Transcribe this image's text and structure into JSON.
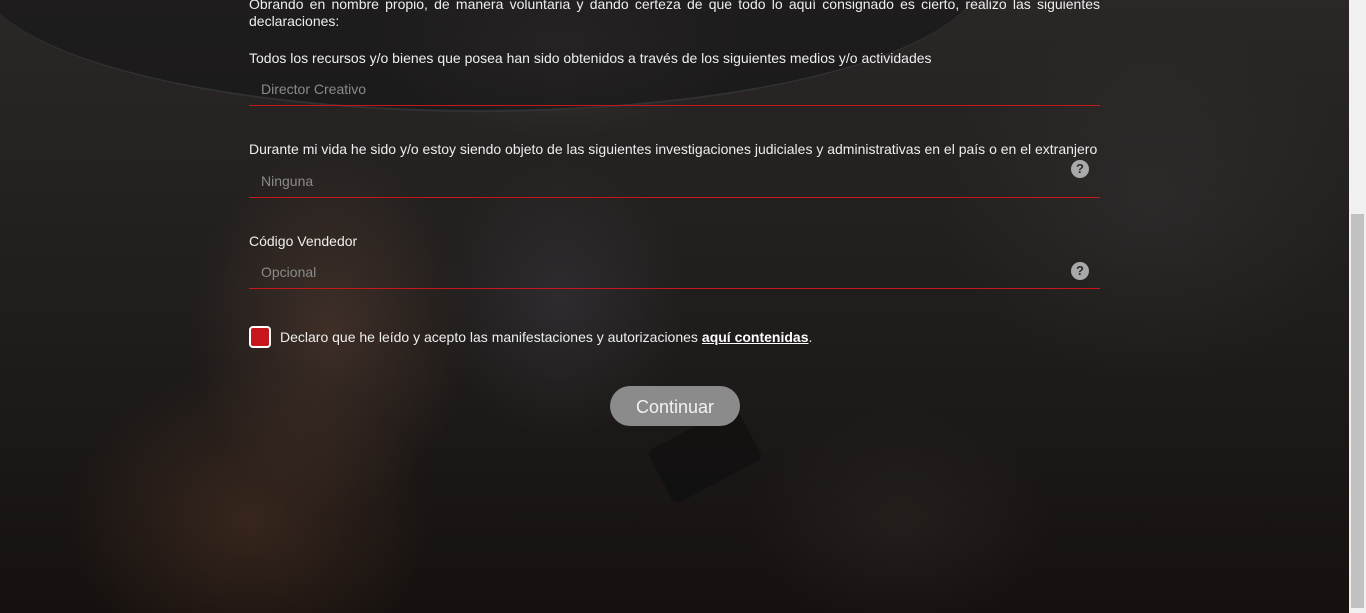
{
  "intro": {
    "text": "Obrando en nombre propio, de manera voluntaria y dando certeza de que todo lo aquí consignado es cierto, realizo las siguientes declaraciones:"
  },
  "fields": [
    {
      "label": "Todos los recursos y/o bienes que posea han sido obtenidos a través de los siguientes medios y/o actividades",
      "placeholder": "Director Creativo",
      "help": false
    },
    {
      "label": "Durante mi vida he sido y/o estoy siendo objeto de las siguientes investigaciones judiciales y administrativas en el país o en el extranjero",
      "placeholder": "Ninguna",
      "help": true
    },
    {
      "label": "Código Vendedor",
      "placeholder": "Opcional",
      "help": true
    }
  ],
  "help_icon_glyph": "?",
  "consent": {
    "checked": true,
    "text": "Declaro que he leído y acepto las manifestaciones y autorizaciones",
    "link_text": "aquí contenidas",
    "suffix": "."
  },
  "submit": {
    "label": "Continuar"
  },
  "colors": {
    "accent": "#c8161d",
    "button_bg": "#8b8b8b"
  }
}
